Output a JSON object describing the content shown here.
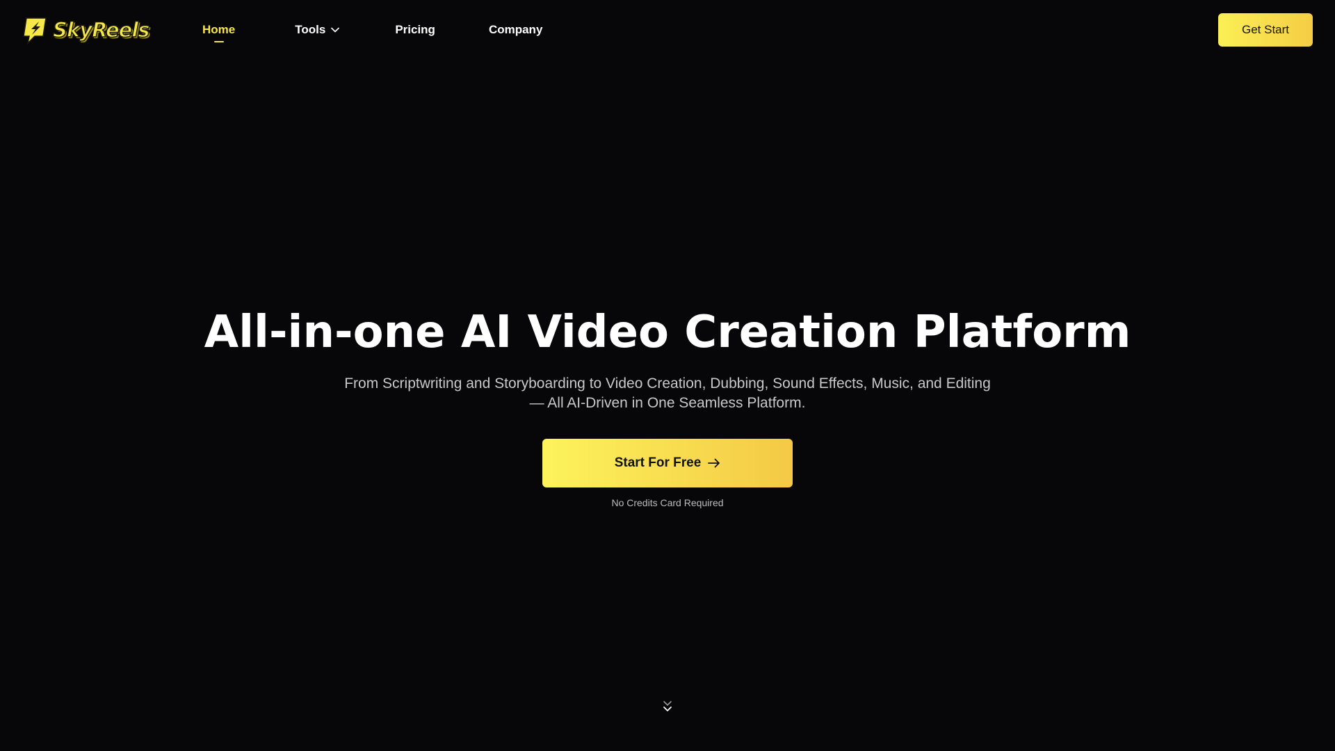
{
  "brand": {
    "name": "SkyReels",
    "accent_color": "#f7e84a"
  },
  "nav": {
    "items": [
      {
        "label": "Home",
        "active": true
      },
      {
        "label": "Tools",
        "icon": "chevron-down-icon"
      },
      {
        "label": "Pricing"
      },
      {
        "label": "Company"
      }
    ]
  },
  "header": {
    "cta_label": "Get Start"
  },
  "hero": {
    "title": "All-in-one AI Video Creation Platform",
    "subtitle_line1": "From Scriptwriting and Storyboarding to Video Creation, Dubbing, Sound Effects, Music, and Editing",
    "subtitle_line2": "— All AI-Driven in One Seamless Platform.",
    "cta_label": "Start For Free",
    "cta_icon": "arrow-right-icon",
    "note": "No Credits Card Required",
    "scroll_icon": "double-chevron-down-icon"
  },
  "colors": {
    "background": "#070709",
    "button_gradient_start": "#fdf35c",
    "button_gradient_end": "#f4c945",
    "text_primary": "#ffffff",
    "text_secondary": "#c9c9cc"
  }
}
